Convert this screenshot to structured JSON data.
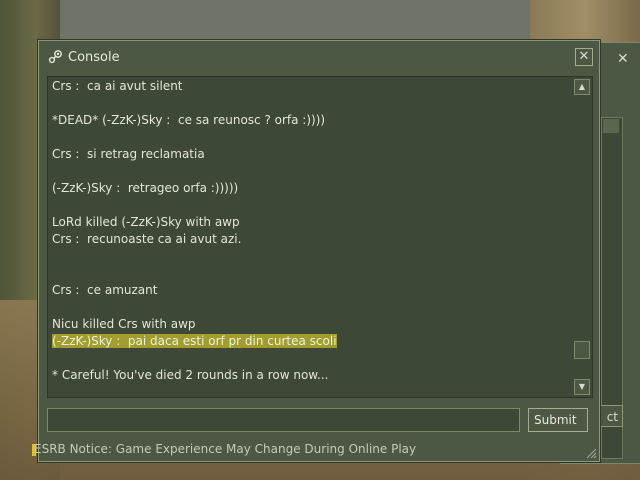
{
  "console": {
    "title": "Console",
    "icon": "steam-icon",
    "close_label": "✕",
    "log_lines": [
      {
        "text": "Crs :  ca ai avut silent",
        "highlight": false
      },
      {
        "text": "",
        "highlight": false
      },
      {
        "text": "*DEAD* (-ZzK-)Sky :  ce sa reunosc ? orfa :))))",
        "highlight": false
      },
      {
        "text": "",
        "highlight": false
      },
      {
        "text": "Crs :  si retrag reclamatia",
        "highlight": false
      },
      {
        "text": "",
        "highlight": false
      },
      {
        "text": "(-ZzK-)Sky :  retrageo orfa :)))))",
        "highlight": false
      },
      {
        "text": "",
        "highlight": false
      },
      {
        "text": "LoRd killed (-ZzK-)Sky with awp",
        "highlight": false
      },
      {
        "text": "Crs :  recunoaste ca ai avut azi.",
        "highlight": false
      },
      {
        "text": "",
        "highlight": false
      },
      {
        "text": "",
        "highlight": false
      },
      {
        "text": "Crs :  ce amuzant",
        "highlight": false
      },
      {
        "text": "",
        "highlight": false
      },
      {
        "text": "Nicu killed Crs with awp",
        "highlight": false
      },
      {
        "text": "(-ZzK-)Sky :  pai daca esti orf pr din curtea scoli",
        "highlight": true
      },
      {
        "text": "",
        "highlight": false
      },
      {
        "text": "* Careful! You've died 2 rounds in a row now...",
        "highlight": false
      }
    ],
    "input_value": "",
    "submit_label": "Submit"
  },
  "background_window": {
    "close_label": "✕",
    "button_label_partial": "ct"
  },
  "esrb_notice": "ESRB Notice: Game Experience May Change During Online Play",
  "colors": {
    "panel": "#4c5844",
    "panel_dark": "#3e4836",
    "highlight": "#a19d2e",
    "text": "#e3e6d8"
  }
}
